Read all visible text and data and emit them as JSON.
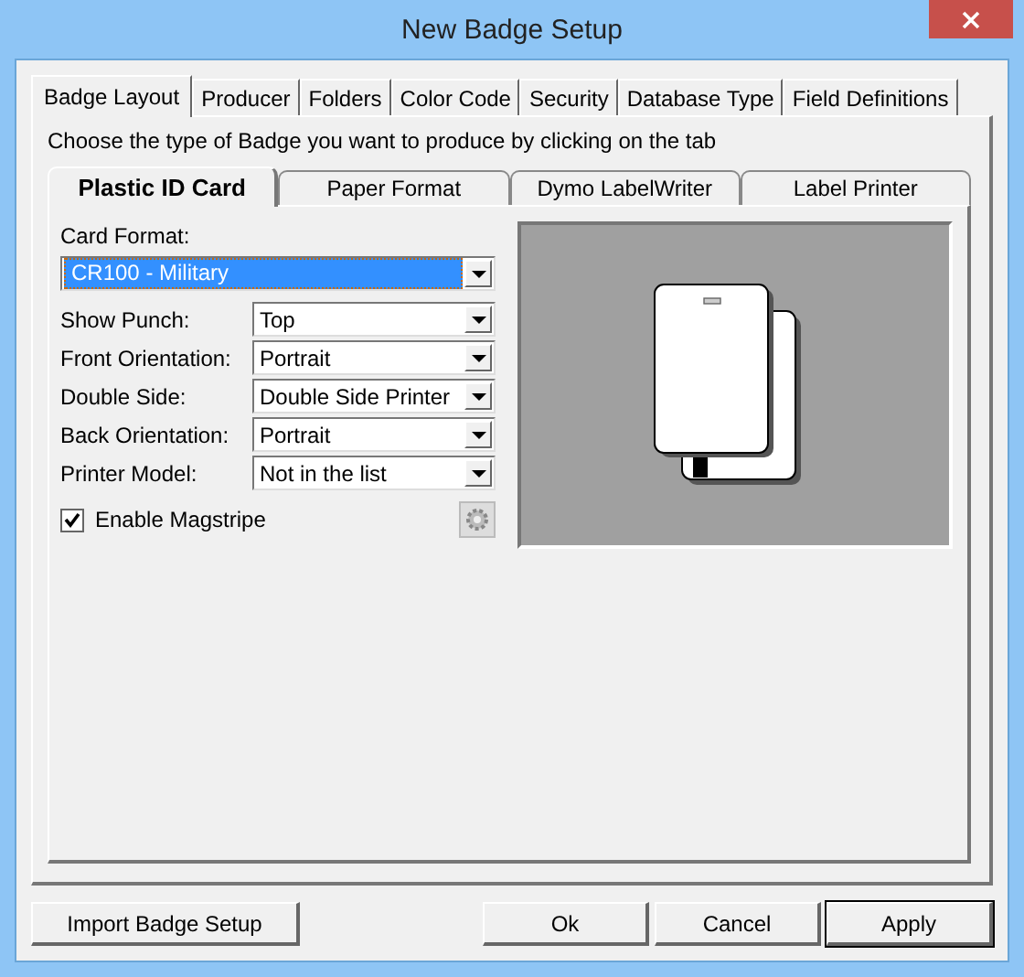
{
  "window": {
    "title": "New Badge Setup"
  },
  "tabs": [
    {
      "label": "Badge Layout",
      "selected": true
    },
    {
      "label": "Producer",
      "selected": false
    },
    {
      "label": "Folders",
      "selected": false
    },
    {
      "label": "Color Code",
      "selected": false
    },
    {
      "label": "Security",
      "selected": false
    },
    {
      "label": "Database Type",
      "selected": false
    },
    {
      "label": "Field Definitions",
      "selected": false
    }
  ],
  "instruction": "Choose the type of Badge you want to produce by clicking on the tab",
  "badge_tabs": [
    {
      "label": "Plastic ID Card",
      "selected": true
    },
    {
      "label": "Paper Format",
      "selected": false
    },
    {
      "label": "Dymo LabelWriter",
      "selected": false
    },
    {
      "label": "Label Printer",
      "selected": false
    }
  ],
  "card_format": {
    "label": "Card Format:",
    "value": "CR100 - Military"
  },
  "fields": [
    {
      "label": "Show Punch:",
      "value": "Top"
    },
    {
      "label": "Front Orientation:",
      "value": "Portrait"
    },
    {
      "label": "Double Side:",
      "value": "Double Side Printer"
    },
    {
      "label": "Back Orientation:",
      "value": "Portrait"
    },
    {
      "label": "Printer Model:",
      "value": "Not in the list"
    }
  ],
  "magstripe": {
    "label": "Enable Magstripe",
    "checked": true
  },
  "buttons": [
    {
      "label": "Import Badge Setup",
      "default": false
    },
    {
      "label": "Ok",
      "default": false
    },
    {
      "label": "Cancel",
      "default": false
    },
    {
      "label": "Apply",
      "default": true
    }
  ]
}
